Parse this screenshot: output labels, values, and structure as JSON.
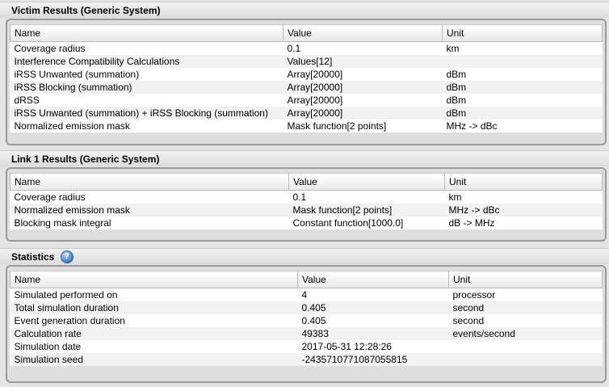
{
  "victim": {
    "title": "Victim Results (Generic System)",
    "columns": [
      "Name",
      "Value",
      "Unit"
    ],
    "rows": [
      [
        "Coverage radius",
        "0.1",
        "km"
      ],
      [
        "Interference Compatibility Calculations",
        "Values[12]",
        ""
      ],
      [
        "iRSS Unwanted (summation)",
        "Array[20000]",
        "dBm"
      ],
      [
        "iRSS Blocking (summation)",
        "Array[20000]",
        "dBm"
      ],
      [
        "dRSS",
        "Array[20000]",
        "dBm"
      ],
      [
        "iRSS Unwanted (summation) + iRSS Blocking (summation)",
        "Array[20000]",
        "dBm"
      ],
      [
        "Normalized emission mask",
        "Mask function[2 points]",
        "MHz -> dBc"
      ]
    ]
  },
  "link1": {
    "title": "Link 1 Results (Generic System)",
    "columns": [
      "Name",
      "Value",
      "Unit"
    ],
    "rows": [
      [
        "Coverage radius",
        "0.1",
        "km"
      ],
      [
        "Normalized emission mask",
        "Mask function[2 points]",
        "MHz -> dBc"
      ],
      [
        "Blocking mask integral",
        "Constant function[1000.0]",
        "dB -> MHz"
      ]
    ]
  },
  "statistics": {
    "title": "Statistics",
    "help_icon": "help-icon",
    "columns": [
      "Name",
      "Value",
      "Unit"
    ],
    "rows": [
      [
        "Simulated performed on",
        "4",
        "processor"
      ],
      [
        "Total simulation duration",
        "0.405",
        "second"
      ],
      [
        "Event generation duration",
        "0.405",
        "second"
      ],
      [
        "Calculation rate",
        "49383",
        "events/second"
      ],
      [
        "Simulation date",
        "2017-05-31 12:28:26",
        ""
      ],
      [
        "Simulation seed",
        "-2435710771087055815",
        ""
      ]
    ]
  }
}
